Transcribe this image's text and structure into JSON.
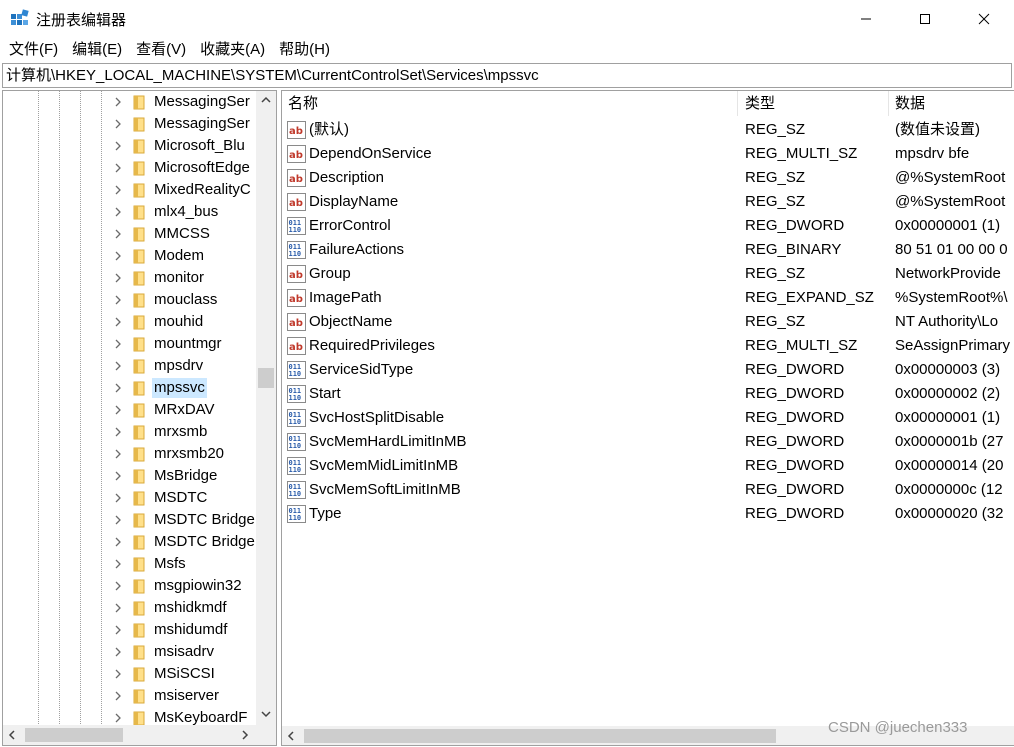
{
  "window": {
    "title": "注册表编辑器",
    "icon": "regedit-icon",
    "buttons": {
      "minimize": "minimize-icon",
      "maximize": "maximize-icon",
      "close": "close-icon"
    }
  },
  "menu": [
    {
      "label": "文件(F)"
    },
    {
      "label": "编辑(E)"
    },
    {
      "label": "查看(V)"
    },
    {
      "label": "收藏夹(A)"
    },
    {
      "label": "帮助(H)"
    }
  ],
  "address": "计算机\\HKEY_LOCAL_MACHINE\\SYSTEM\\CurrentControlSet\\Services\\mpssvc",
  "tree": {
    "selected": "mpssvc",
    "items": [
      {
        "label": "MessagingSer"
      },
      {
        "label": "MessagingSer"
      },
      {
        "label": "Microsoft_Blu"
      },
      {
        "label": "MicrosoftEdge"
      },
      {
        "label": "MixedRealityC"
      },
      {
        "label": "mlx4_bus"
      },
      {
        "label": "MMCSS"
      },
      {
        "label": "Modem"
      },
      {
        "label": "monitor"
      },
      {
        "label": "mouclass"
      },
      {
        "label": "mouhid"
      },
      {
        "label": "mountmgr"
      },
      {
        "label": "mpsdrv"
      },
      {
        "label": "mpssvc"
      },
      {
        "label": "MRxDAV"
      },
      {
        "label": "mrxsmb"
      },
      {
        "label": "mrxsmb20"
      },
      {
        "label": "MsBridge"
      },
      {
        "label": "MSDTC"
      },
      {
        "label": "MSDTC Bridge"
      },
      {
        "label": "MSDTC Bridge"
      },
      {
        "label": "Msfs"
      },
      {
        "label": "msgpiowin32"
      },
      {
        "label": "mshidkmdf"
      },
      {
        "label": "mshidumdf"
      },
      {
        "label": "msisadrv"
      },
      {
        "label": "MSiSCSI"
      },
      {
        "label": "msiserver"
      },
      {
        "label": "MsKeyboardF"
      }
    ]
  },
  "columns": {
    "name": "名称",
    "type": "类型",
    "data": "数据"
  },
  "values": [
    {
      "icon": "string-value-icon",
      "name": "(默认)",
      "type": "REG_SZ",
      "data": "(数值未设置)"
    },
    {
      "icon": "string-value-icon",
      "name": "DependOnService",
      "type": "REG_MULTI_SZ",
      "data": "mpsdrv bfe"
    },
    {
      "icon": "string-value-icon",
      "name": "Description",
      "type": "REG_SZ",
      "data": "@%SystemRoot"
    },
    {
      "icon": "string-value-icon",
      "name": "DisplayName",
      "type": "REG_SZ",
      "data": "@%SystemRoot"
    },
    {
      "icon": "binary-value-icon",
      "name": "ErrorControl",
      "type": "REG_DWORD",
      "data": "0x00000001 (1)"
    },
    {
      "icon": "binary-value-icon",
      "name": "FailureActions",
      "type": "REG_BINARY",
      "data": "80 51 01 00 00 0"
    },
    {
      "icon": "string-value-icon",
      "name": "Group",
      "type": "REG_SZ",
      "data": "NetworkProvide"
    },
    {
      "icon": "string-value-icon",
      "name": "ImagePath",
      "type": "REG_EXPAND_SZ",
      "data": "%SystemRoot%\\"
    },
    {
      "icon": "string-value-icon",
      "name": "ObjectName",
      "type": "REG_SZ",
      "data": "NT Authority\\Lo"
    },
    {
      "icon": "string-value-icon",
      "name": "RequiredPrivileges",
      "type": "REG_MULTI_SZ",
      "data": "SeAssignPrimary"
    },
    {
      "icon": "binary-value-icon",
      "name": "ServiceSidType",
      "type": "REG_DWORD",
      "data": "0x00000003 (3)"
    },
    {
      "icon": "binary-value-icon",
      "name": "Start",
      "type": "REG_DWORD",
      "data": "0x00000002 (2)"
    },
    {
      "icon": "binary-value-icon",
      "name": "SvcHostSplitDisable",
      "type": "REG_DWORD",
      "data": "0x00000001 (1)"
    },
    {
      "icon": "binary-value-icon",
      "name": "SvcMemHardLimitInMB",
      "type": "REG_DWORD",
      "data": "0x0000001b (27"
    },
    {
      "icon": "binary-value-icon",
      "name": "SvcMemMidLimitInMB",
      "type": "REG_DWORD",
      "data": "0x00000014 (20"
    },
    {
      "icon": "binary-value-icon",
      "name": "SvcMemSoftLimitInMB",
      "type": "REG_DWORD",
      "data": "0x0000000c (12"
    },
    {
      "icon": "binary-value-icon",
      "name": "Type",
      "type": "REG_DWORD",
      "data": "0x00000020 (32"
    }
  ],
  "watermark": "CSDN @juechen333",
  "colors": {
    "selection": "#cce8ff",
    "scrollbar": "#f0f0f0",
    "thumb": "#cdcdcd",
    "string_icon": "#c0392b",
    "binary_icon": "#2a5caa"
  }
}
